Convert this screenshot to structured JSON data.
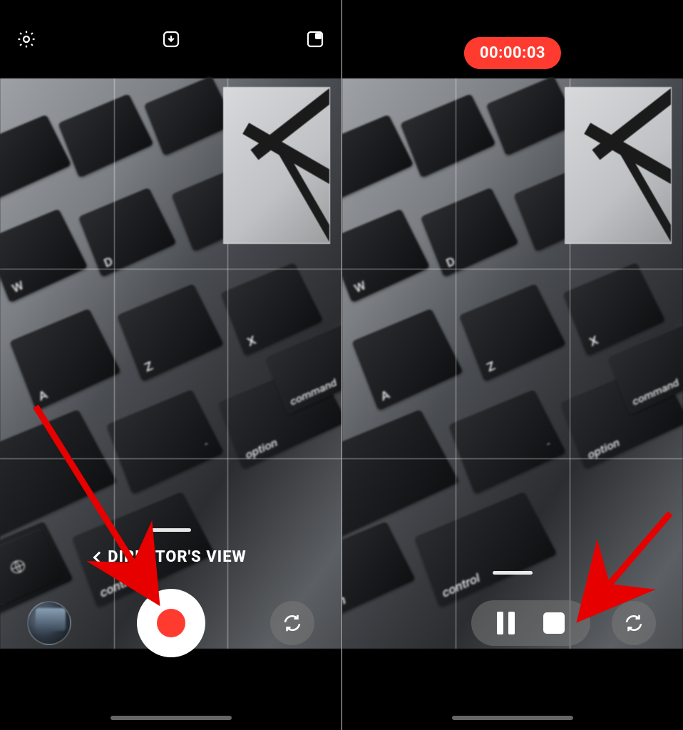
{
  "left": {
    "toolbar": {
      "settings_icon": "gear-icon",
      "save_icon": "download-tray-icon",
      "layout_icon": "pip-layout-icon"
    },
    "mode_label": "DIRECTOR'S VIEW",
    "controls": {
      "gallery_thumb": "gallery-thumbnail",
      "record": "record",
      "switch_camera": "switch-camera"
    }
  },
  "right": {
    "recording_time": "00:00:03",
    "controls": {
      "pause": "pause",
      "stop": "stop",
      "switch_camera": "switch-camera"
    }
  },
  "colors": {
    "record_red": "#ff3b30"
  }
}
